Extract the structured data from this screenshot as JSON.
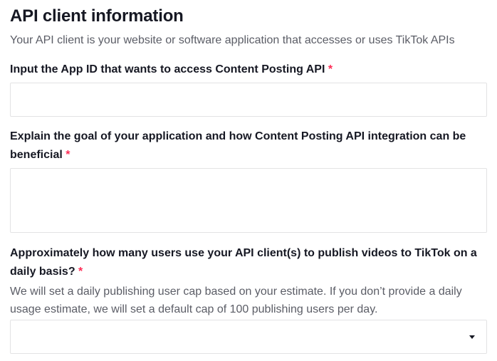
{
  "section": {
    "title": "API client information",
    "subtitle": "Your API client is your website or software application that accesses or uses TikTok APIs"
  },
  "fields": {
    "app_id": {
      "label": "Input the App ID that wants to access Content Posting API",
      "required_mark": "*",
      "value": ""
    },
    "goal": {
      "label": "Explain the goal of your application and how Content Posting API integration can be beneficial",
      "required_mark": "*",
      "value": ""
    },
    "daily_users": {
      "label": "Approximately how many users use your API client(s) to publish videos to TikTok on a daily basis?",
      "required_mark": "*",
      "help": "We will set a daily publishing user cap based on your estimate. If you don’t provide a daily usage estimate, we will set a default cap of 100 publishing users per day.",
      "selected_value": ""
    }
  },
  "icons": {
    "dropdown": "caret-down-icon"
  },
  "colors": {
    "text": "#161823",
    "muted_text": "#5b5d66",
    "required": "#fe2c55",
    "border": "#e3e3e4"
  }
}
